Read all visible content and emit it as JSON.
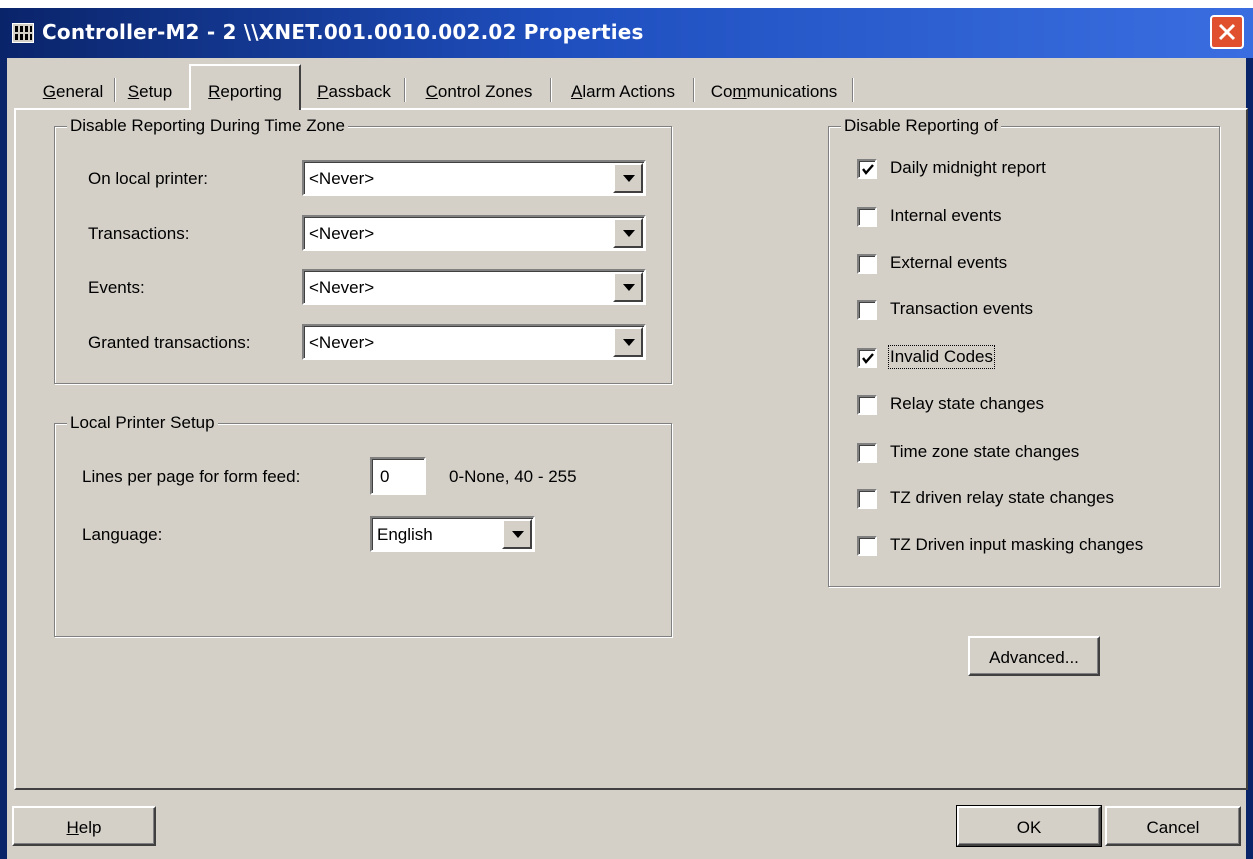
{
  "window": {
    "title": "Controller-M2 - 2 \\\\XNET.001.0010.002.02 Properties",
    "colors": {
      "titlebar": "#0a246a",
      "face": "#d4d0c8",
      "close": "#e0502e"
    }
  },
  "tabs": [
    {
      "label": "General",
      "accel": "G",
      "rest": "eneral",
      "active": false
    },
    {
      "label": "Setup",
      "accel": "S",
      "rest": "etup",
      "active": false
    },
    {
      "label": "Reporting",
      "accel": "R",
      "rest": "eporting",
      "active": true
    },
    {
      "label": "Passback",
      "accel": "P",
      "rest": "assback",
      "active": false
    },
    {
      "label": "Control Zones",
      "accel": "C",
      "rest": "ontrol Zones",
      "active": false
    },
    {
      "label": "Alarm Actions",
      "accel": "A",
      "rest": "larm Actions",
      "active": false
    },
    {
      "label": "Communications",
      "pre": "Co",
      "accel": "m",
      "rest": "munications",
      "active": false
    }
  ],
  "disable_time_zone": {
    "title": "Disable Reporting During Time Zone",
    "rows": [
      {
        "label": "On local printer:",
        "value": "<Never>"
      },
      {
        "label": "Transactions:",
        "value": "<Never>"
      },
      {
        "label": "Events:",
        "value": "<Never>"
      },
      {
        "label": "Granted transactions:",
        "value": "<Never>"
      }
    ]
  },
  "printer_setup": {
    "title": "Local Printer Setup",
    "lines_label": "Lines per page for form feed:",
    "lines_value": "0",
    "lines_hint": "0-None, 40 - 255",
    "language_label": "Language:",
    "language_value": "English"
  },
  "disable_reporting": {
    "title": "Disable Reporting of",
    "items": [
      {
        "label": "Daily midnight report",
        "checked": true
      },
      {
        "label": "Internal events",
        "checked": false
      },
      {
        "label": "External events",
        "checked": false
      },
      {
        "label": "Transaction events",
        "checked": false
      },
      {
        "label": "Invalid Codes",
        "checked": true,
        "focused": true
      },
      {
        "label": "Relay state changes",
        "checked": false
      },
      {
        "label": "Time zone state changes",
        "checked": false
      },
      {
        "label": "TZ driven relay state changes",
        "checked": false
      },
      {
        "label": "TZ Driven input masking changes",
        "checked": false
      }
    ]
  },
  "buttons": {
    "advanced": "Advanced...",
    "help_accel": "H",
    "help_rest": "elp",
    "ok": "OK",
    "cancel": "Cancel"
  }
}
